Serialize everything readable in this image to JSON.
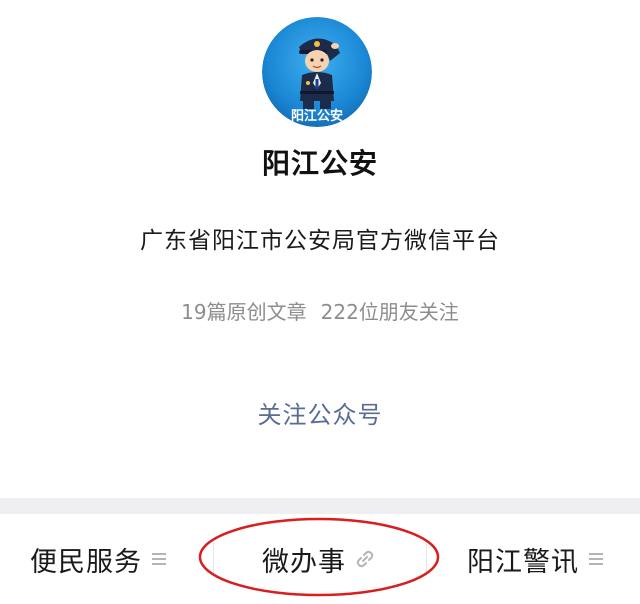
{
  "profile": {
    "avatar_text": "阳江公安",
    "name": "阳江公安",
    "description": "广东省阳江市公安局官方微信平台",
    "stats": {
      "articles": "19篇原创文章",
      "followers": "222位朋友关注"
    },
    "follow_button_label": "关注公众号"
  },
  "menu": {
    "items": [
      {
        "label": "便民服务",
        "icon": "list-icon"
      },
      {
        "label": "微办事",
        "icon": "link-icon"
      },
      {
        "label": "阳江警讯",
        "icon": "list-icon"
      }
    ]
  },
  "colors": {
    "link_blue": "#586c94",
    "stats_gray": "#8d8d8d",
    "highlight_red": "#d81e1e",
    "avatar_blue": "#1d88d6"
  }
}
